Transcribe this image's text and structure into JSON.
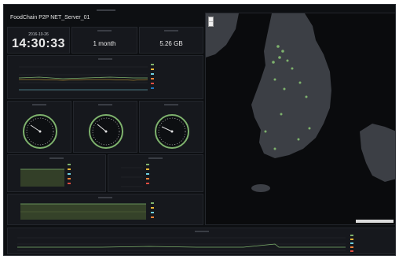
{
  "dashboard": {
    "title": "FoodChain P2P NET_Server_01"
  },
  "stats": {
    "clock": {
      "date": "2016-10-26",
      "time": "14:30:33"
    },
    "uptime": {
      "value": "1 month"
    },
    "storage": {
      "value": "5.26 GB"
    }
  },
  "colors": {
    "panel_bg": "#16181d",
    "accent_green": "#7eb26d",
    "accent_yellow": "#e5ac0e",
    "text": "#d8d9da"
  },
  "map": {
    "zoom_in_icon": "plus-icon",
    "zoom_out_icon": "minus-icon"
  }
}
